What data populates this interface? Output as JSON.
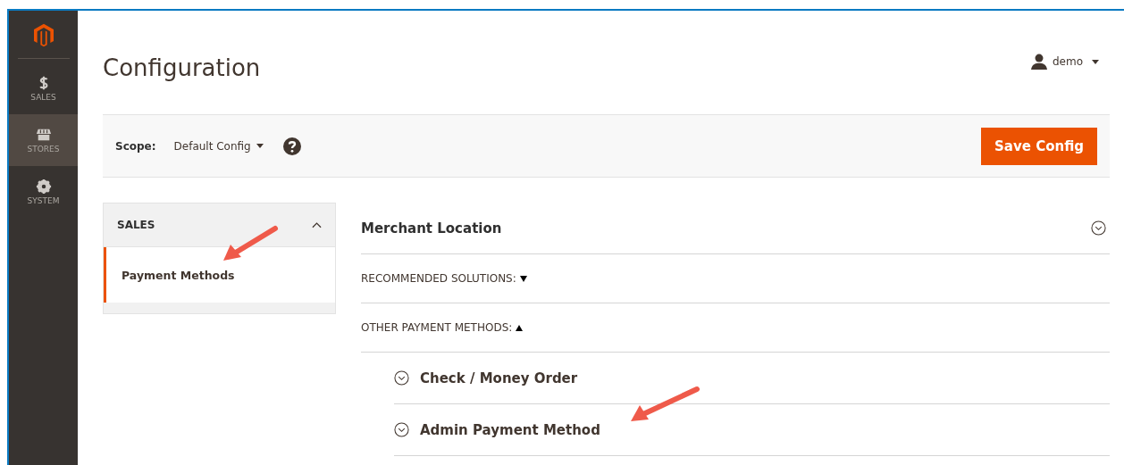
{
  "nav": [
    {
      "label": "SALES",
      "kind": "dollar",
      "selected": false
    },
    {
      "label": "STORES",
      "kind": "store",
      "selected": true
    },
    {
      "label": "SYSTEM",
      "kind": "gear",
      "selected": false
    }
  ],
  "page_title": "Configuration",
  "user": {
    "name": "demo"
  },
  "scope": {
    "label": "Scope:",
    "value": "Default Config"
  },
  "save_button": "Save Config",
  "config_tabs": {
    "title": "SALES",
    "expanded": true,
    "items": [
      {
        "label": "Payment Methods",
        "selected": true
      }
    ]
  },
  "section": {
    "title": "Merchant Location",
    "expanded": false
  },
  "groups": [
    {
      "label": "RECOMMENDED SOLUTIONS:",
      "expanded": false
    },
    {
      "label": "OTHER PAYMENT METHODS:",
      "expanded": true
    }
  ],
  "methods": [
    {
      "label": "Check / Money Order",
      "expanded": false
    },
    {
      "label": "Admin Payment Method",
      "expanded": false
    }
  ]
}
